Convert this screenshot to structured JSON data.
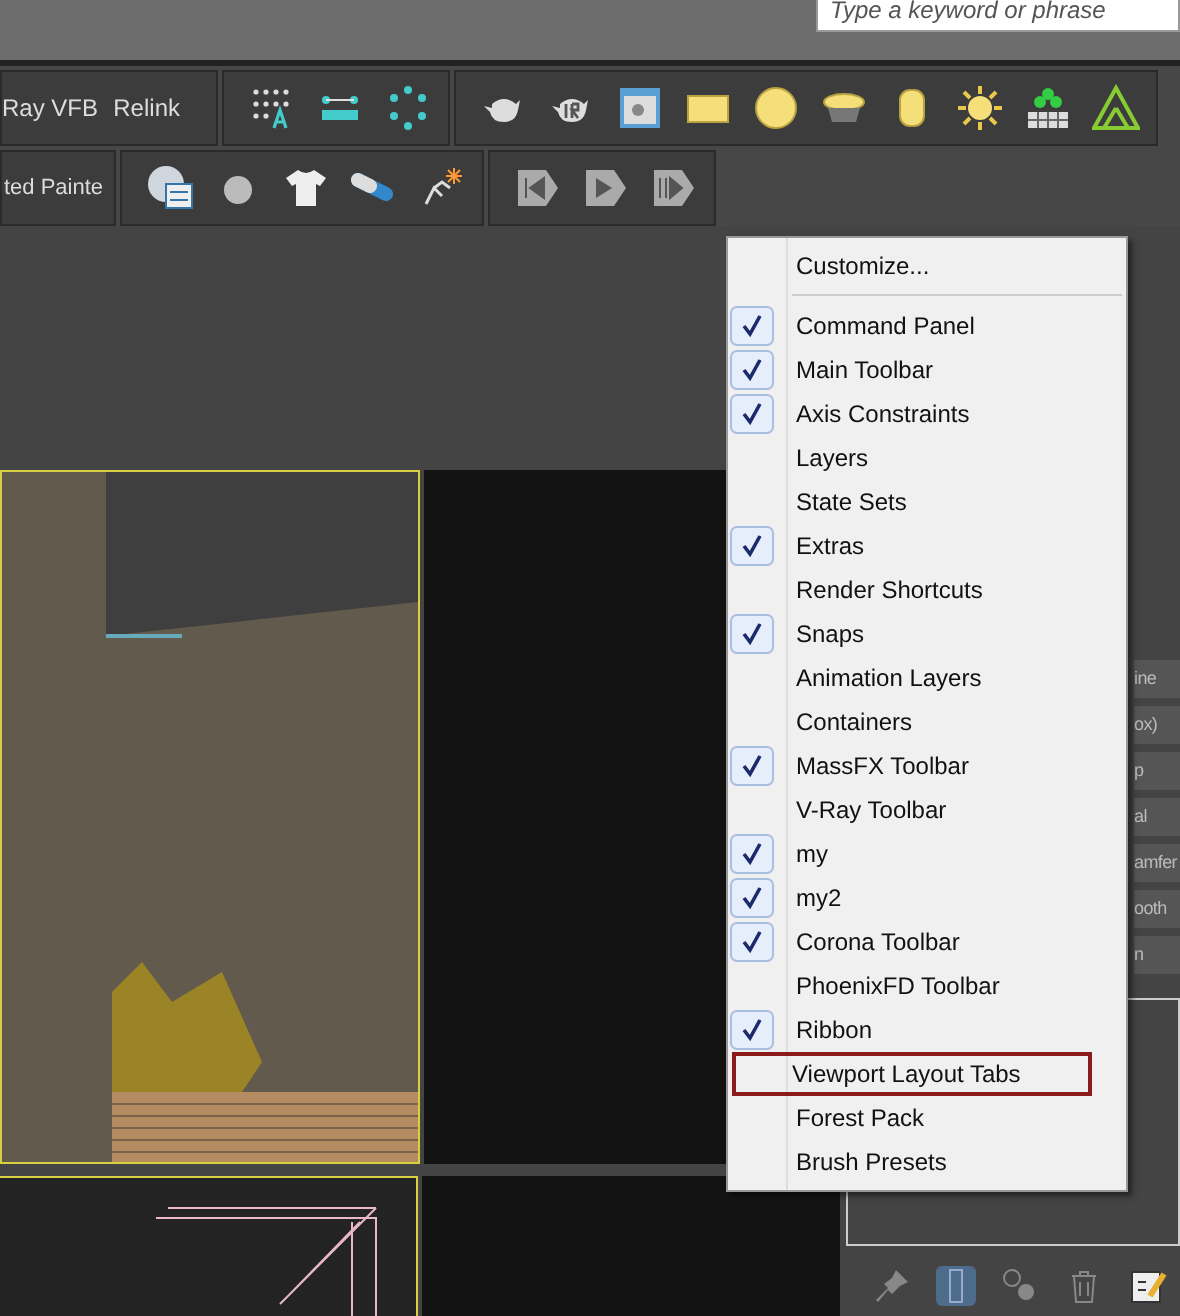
{
  "search": {
    "placeholder": "Type a keyword or phrase"
  },
  "toolbar_row_1": {
    "buttons": [
      "Ray VFB",
      "Relink"
    ]
  },
  "toolbar_row_2": {
    "label": "ted Painte"
  },
  "command_panel": {
    "fragments": [
      "ine",
      "ox)",
      "p",
      "al",
      "amfer",
      "ooth",
      "n"
    ]
  },
  "context_menu": {
    "header": "Customize...",
    "items": [
      {
        "label": "Command Panel",
        "checked": true,
        "highlighted": false
      },
      {
        "label": "Main Toolbar",
        "checked": true,
        "highlighted": false
      },
      {
        "label": "Axis Constraints",
        "checked": true,
        "highlighted": false
      },
      {
        "label": "Layers",
        "checked": false,
        "highlighted": false
      },
      {
        "label": "State Sets",
        "checked": false,
        "highlighted": false
      },
      {
        "label": "Extras",
        "checked": true,
        "highlighted": false
      },
      {
        "label": "Render Shortcuts",
        "checked": false,
        "highlighted": false
      },
      {
        "label": "Snaps",
        "checked": true,
        "highlighted": false
      },
      {
        "label": "Animation Layers",
        "checked": false,
        "highlighted": false
      },
      {
        "label": "Containers",
        "checked": false,
        "highlighted": false
      },
      {
        "label": "MassFX Toolbar",
        "checked": true,
        "highlighted": false
      },
      {
        "label": "V-Ray Toolbar",
        "checked": false,
        "highlighted": false
      },
      {
        "label": "my",
        "checked": true,
        "highlighted": false
      },
      {
        "label": "my2",
        "checked": true,
        "highlighted": false
      },
      {
        "label": "Corona Toolbar",
        "checked": true,
        "highlighted": false
      },
      {
        "label": "PhoenixFD Toolbar",
        "checked": false,
        "highlighted": false
      },
      {
        "label": "Ribbon",
        "checked": true,
        "highlighted": false
      },
      {
        "label": "Viewport Layout Tabs",
        "checked": false,
        "highlighted": true
      },
      {
        "label": "Forest Pack",
        "checked": false,
        "highlighted": false
      },
      {
        "label": "Brush Presets",
        "checked": false,
        "highlighted": false
      }
    ]
  }
}
